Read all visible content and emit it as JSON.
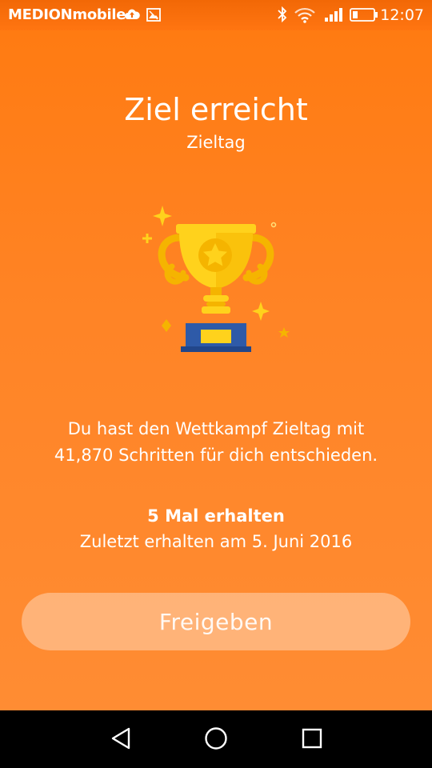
{
  "status_bar": {
    "carrier": "MEDIONmobile",
    "time": "12:07",
    "icons": [
      "cloud-upload-icon",
      "image-icon",
      "bluetooth-icon",
      "wifi-icon",
      "signal-icon",
      "battery-icon"
    ]
  },
  "header": {
    "title": "Ziel erreicht",
    "subtitle": "Zieltag"
  },
  "badge": {
    "icon": "trophy-icon",
    "colors": {
      "cup": "#ffd21c",
      "cup_shade": "#f5b400",
      "base": "#2e5aa8",
      "sparkle": "#ffd21c"
    }
  },
  "message": {
    "line1": "Du hast den Wettkampf Zieltag mit",
    "line2": "41,870 Schritten für dich entschieden."
  },
  "stats": {
    "count": "5 Mal erhalten",
    "last_received": "Zuletzt erhalten am 5. Juni 2016"
  },
  "actions": {
    "share_label": "Freigeben"
  },
  "nav_bar": {
    "icons": [
      "back-icon",
      "home-icon",
      "recents-icon"
    ]
  },
  "colors": {
    "background": "#ff7a10",
    "button_fill": "rgba(255,255,255,0.35)"
  }
}
